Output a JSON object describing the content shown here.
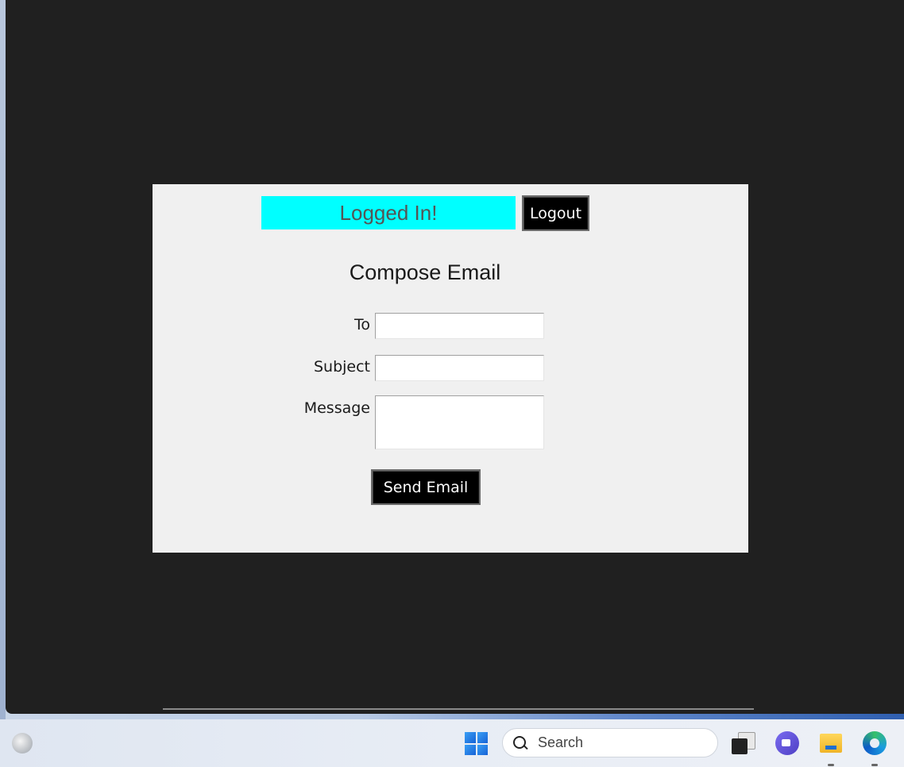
{
  "app": {
    "status_text": "Logged In!",
    "logout_label": "Logout",
    "heading": "Compose Email",
    "fields": {
      "to_label": "To",
      "to_value": "",
      "subject_label": "Subject",
      "subject_value": "",
      "message_label": "Message",
      "message_value": ""
    },
    "send_label": "Send Email",
    "colors": {
      "status_bg": "#00ffff",
      "button_bg": "#000000",
      "dialog_bg": "#f0f0f0",
      "backdrop": "#202020"
    }
  },
  "taskbar": {
    "search_placeholder": "Search",
    "icons": [
      "edge-dev-icon",
      "windows-start-icon",
      "search-icon",
      "task-view-icon",
      "teams-meet-icon",
      "file-explorer-icon",
      "edge-icon"
    ]
  }
}
